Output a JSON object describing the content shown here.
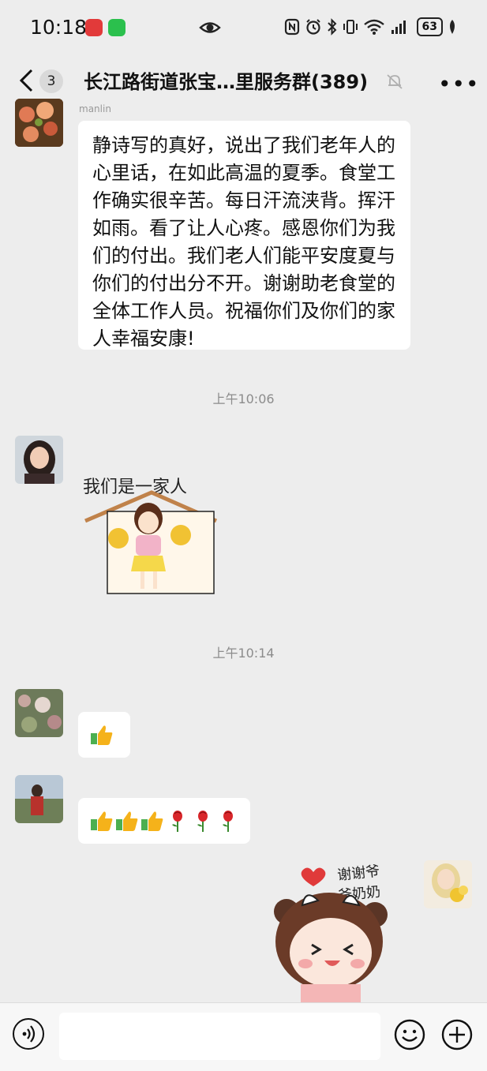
{
  "status": {
    "time": "10:18",
    "battery": "63"
  },
  "header": {
    "unread_count": "3",
    "title": "长江路街道张宝…里服务群(389)"
  },
  "messages": [
    {
      "type": "text",
      "sender": "manlin",
      "text": "静诗写的真好，说出了我们老年人的心里话，在如此高温的夏季。食堂工作确实很辛苦。每日汗流浃背。挥汗如雨。看了让人心疼。感恩你们为我们的付出。我们老人们能平安度夏与你们的付出分不开。谢谢助老食堂的全体工作人员。祝福你们及你们的家人幸福安康!"
    },
    {
      "type": "time",
      "text": "上午10:06"
    },
    {
      "type": "sticker",
      "sticker_text": "我们是一家人"
    },
    {
      "type": "time",
      "text": "上午10:14"
    },
    {
      "type": "emoji",
      "emojis": [
        "thumbs-up"
      ]
    },
    {
      "type": "emoji",
      "emojis": [
        "thumbs-up",
        "thumbs-up",
        "thumbs-up",
        "rose",
        "rose",
        "rose"
      ]
    },
    {
      "type": "sticker",
      "sticker_text": "谢谢爷爷奶奶",
      "self": true
    }
  ],
  "colors": {
    "background": "#ededed",
    "bubble": "#ffffff",
    "timestamp": "#8c8c8c",
    "thumb_yellow": "#f5b21a",
    "sleeve_green": "#4caf50",
    "rose_red": "#d9262a"
  }
}
